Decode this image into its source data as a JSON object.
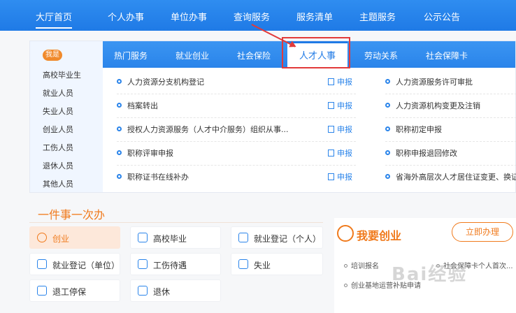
{
  "topnav": [
    "大厅首页",
    "个人办事",
    "单位办事",
    "查询服务",
    "服务清单",
    "主题服务",
    "公示公告"
  ],
  "sidebar": {
    "badge": "我是",
    "items": [
      "高校毕业生",
      "就业人员",
      "失业人员",
      "创业人员",
      "工伤人员",
      "退休人员",
      "其他人员"
    ]
  },
  "tabs": [
    "热门服务",
    "就业创业",
    "社会保险",
    "人才人事",
    "劳动关系",
    "社会保障卡"
  ],
  "apply_label": "申报",
  "left_services": [
    "人力资源分支机构登记",
    "档案转出",
    "授权人力资源服务（人才中介服务）组织从事...",
    "职称评审申报",
    "职称证书在线补办"
  ],
  "right_services": [
    "人力资源服务许可审批",
    "人力资源机构变更及注销",
    "职称初定申报",
    "职称申报退回修改",
    "省海外高层次人才居住证变更、换证申"
  ],
  "oneThing": {
    "title": "一件事一次办",
    "items": [
      "创业",
      "高校毕业",
      "就业登记（个人）",
      "就业登记（单位）",
      "工伤待遇",
      "失业",
      "退工停保",
      "退休"
    ]
  },
  "startup": {
    "title": "我要创业",
    "button": "立即办理",
    "list": [
      "培训报名",
      "社会保障卡个人首次...",
      "创业基地运营补贴申请"
    ]
  },
  "watermark": "Bai经验"
}
